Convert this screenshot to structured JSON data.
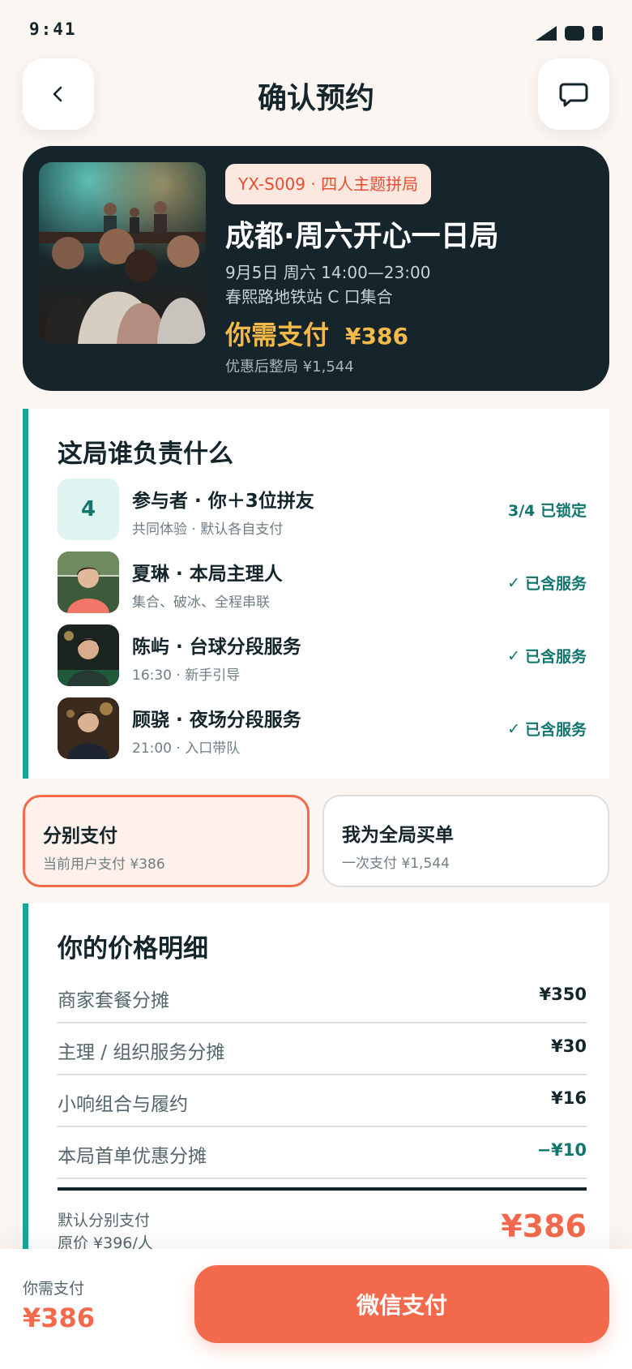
{
  "status_bar": {
    "time": "9:41"
  },
  "header": {
    "title": "确认预约"
  },
  "hero": {
    "tag": "YX-S009 · 四人主题拼局",
    "title": "成都·周六开心一日局",
    "datetime": "9月5日 周六 14:00—23:00",
    "meeting_point": "春熙路地铁站 C 口集合",
    "pay_label": "你需支付",
    "pay_amount": "¥386",
    "group_total": "优惠后整局 ¥1,544"
  },
  "roles": {
    "title": "这局谁负责什么",
    "items": [
      {
        "avatar_text": "4",
        "name": "参与者 · 你＋3位拼友",
        "desc": "共同体验 · 默认各自支付",
        "status": "3/4 已锁定",
        "icon": ""
      },
      {
        "avatar_text": "",
        "name": "夏琳 · 本局主理人",
        "desc": "集合、破冰、全程串联",
        "status": "已含服务",
        "icon": "check-icon"
      },
      {
        "avatar_text": "",
        "name": "陈屿 · 台球分段服务",
        "desc": "16:30 · 新手引导",
        "status": "已含服务",
        "icon": "check-icon"
      },
      {
        "avatar_text": "",
        "name": "顾骁 · 夜场分段服务",
        "desc": "21:00 · 入口带队",
        "status": "已含服务",
        "icon": "check-icon"
      }
    ]
  },
  "payment_options": [
    {
      "title": "分别支付",
      "sub": "当前用户支付 ¥386",
      "selected": true
    },
    {
      "title": "我为全局买单",
      "sub": "一次支付 ¥1,544",
      "selected": false
    }
  ],
  "price_detail": {
    "title": "你的价格明细",
    "rows": [
      {
        "label": "商家套餐分摊",
        "value": "¥350"
      },
      {
        "label": "主理 / 组织服务分摊",
        "value": "¥30"
      },
      {
        "label": "小响组合与履约",
        "value": "¥16"
      },
      {
        "label": "本局首单优惠分摊",
        "value": "−¥10"
      }
    ],
    "total_label": "默认分别支付",
    "original_price": "原价 ¥396/人",
    "total_amount": "¥386"
  },
  "bottom_bar": {
    "label": "你需支付",
    "amount": "¥386",
    "button": "微信支付"
  },
  "colors": {
    "accent": "#f26a4b",
    "teal": "#17a69a",
    "dark": "#15252b",
    "gold": "#f4b949"
  }
}
